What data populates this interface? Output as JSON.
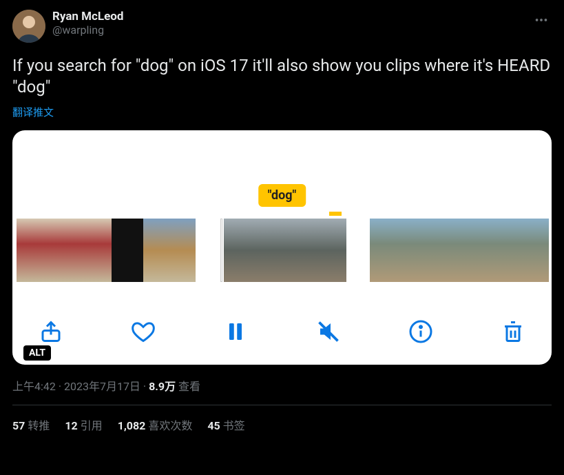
{
  "author": {
    "display_name": "Ryan McLeod",
    "handle": "@warpling"
  },
  "tweet_text": "If you search for \"dog\" on iOS 17 it'll also show you clips where it's HEARD \"dog\"",
  "translate_label": "翻译推文",
  "media": {
    "caption": "\"dog\"",
    "alt_badge": "ALT",
    "icons": {
      "share": "share-icon",
      "heart": "heart-icon",
      "pause": "pause-icon",
      "mute": "mute-icon",
      "info": "info-icon",
      "trash": "trash-icon"
    }
  },
  "meta": {
    "time": "上午4:42",
    "date": "2023年7月17日",
    "separator": " · ",
    "views_number": "8.9万",
    "views_label": " 查看"
  },
  "stats": {
    "retweets": {
      "count": "57",
      "label": " 转推"
    },
    "quotes": {
      "count": "12",
      "label": " 引用"
    },
    "likes": {
      "count": "1,082",
      "label": " 喜欢次数"
    },
    "bookmarks": {
      "count": "45",
      "label": " 书签"
    }
  }
}
